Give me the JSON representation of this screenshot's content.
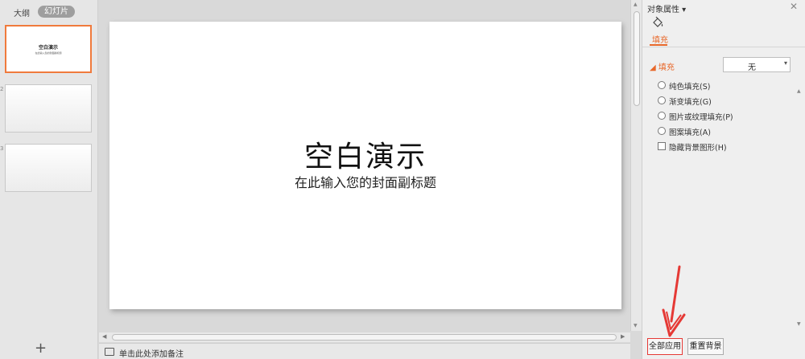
{
  "left_panel": {
    "tabs": {
      "outline": "大纲",
      "slides": "幻灯片"
    },
    "thumbnails": [
      {
        "number": "1",
        "title": "空白演示",
        "subtitle": "在此输入您的封面副标题"
      },
      {
        "number": "2"
      },
      {
        "number": "3"
      }
    ],
    "add_slide": "+"
  },
  "slide": {
    "title": "空白演示",
    "subtitle": "在此输入您的封面副标题"
  },
  "notes": {
    "placeholder": "单击此处添加备注"
  },
  "properties": {
    "title": "对象属性 ▾",
    "close": "✕",
    "fill_tab": "填充",
    "fill_section": "◢ 填充",
    "fill_select_value": "无",
    "options": [
      {
        "type": "radio",
        "label": "纯色填充(S)"
      },
      {
        "type": "radio",
        "label": "渐变填充(G)"
      },
      {
        "type": "radio",
        "label": "图片或纹理填充(P)"
      },
      {
        "type": "radio",
        "label": "图案填充(A)"
      },
      {
        "type": "checkbox",
        "label": "隐藏背景图形(H)"
      }
    ],
    "buttons": {
      "apply_all": "全部应用",
      "reset_background": "重置背景"
    }
  },
  "colors": {
    "accent": "#e8682a",
    "selection_border": "#f07a3c",
    "annotation": "#e53935"
  },
  "icons": [
    "fill-bucket-icon",
    "notes-icon",
    "close-icon",
    "dropdown-arrow-icon",
    "plus-icon"
  ]
}
